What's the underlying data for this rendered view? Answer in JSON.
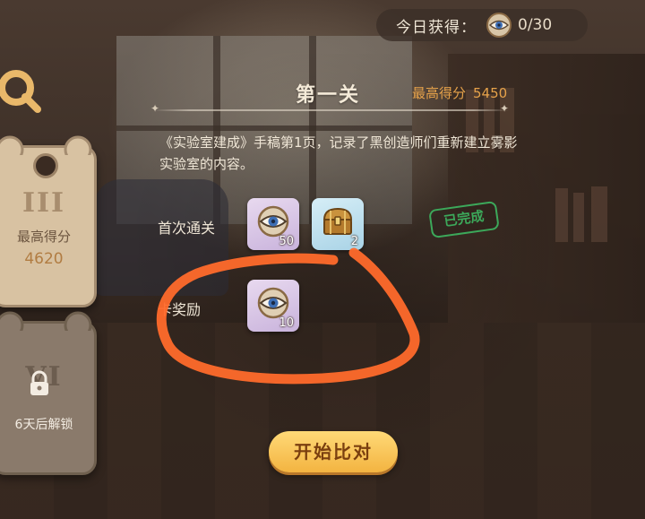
{
  "header": {
    "today_label": "今日获得：",
    "today_count": "0/30",
    "currency_icon": "eye-coin-icon"
  },
  "level_cards": [
    {
      "roman": "III",
      "label": "最高得分",
      "score": "4620",
      "state": "active"
    },
    {
      "roman": "VI",
      "label": "6天后解锁",
      "state": "locked",
      "icon": "lock-icon"
    }
  ],
  "stage": {
    "title": "第一关",
    "best_score_label": "最高得分",
    "best_score_value": "5450",
    "description": "《实验室建成》手稿第1页，记录了黑创造师们重新建立雾影实验室的内容。"
  },
  "rewards": {
    "first_clear_label": "首次通关",
    "first_clear_items": [
      {
        "icon": "eye-coin-icon",
        "qty": "50",
        "bg": "purple"
      },
      {
        "icon": "treasure-chest-icon",
        "qty": "2",
        "bg": "blue"
      }
    ],
    "completed_badge": "已完成",
    "level_reward_label": "关卡奖励",
    "level_reward_label_visible": "卡奖励",
    "level_reward_items": [
      {
        "icon": "eye-coin-icon",
        "qty": "10",
        "bg": "purple"
      }
    ]
  },
  "start_button": "开始比对",
  "colors": {
    "accent_orange": "#e6a24a",
    "completed_green": "#3ca85a",
    "annotation_orange": "#ff6a2b",
    "button_yellow": "#f3b441"
  }
}
